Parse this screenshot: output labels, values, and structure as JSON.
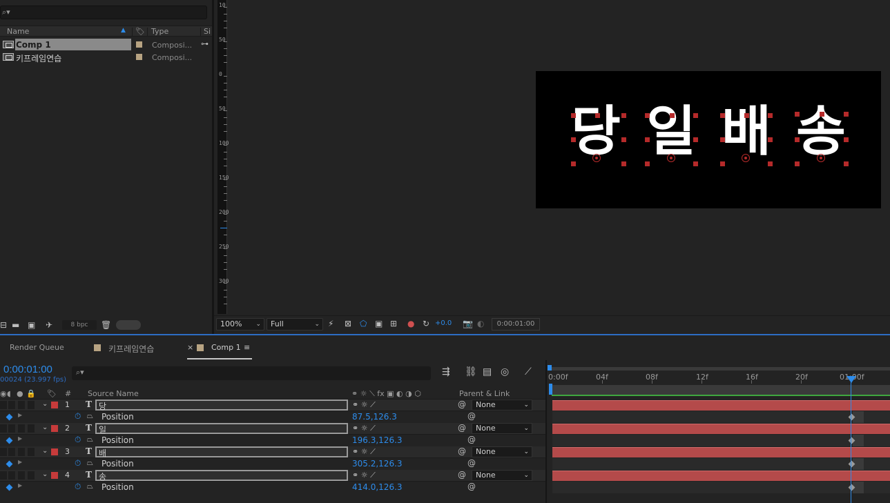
{
  "project": {
    "headers": {
      "name": "Name",
      "type": "Type",
      "size": "Si"
    },
    "items": [
      {
        "name": "Comp 1",
        "type": "Composi..."
      },
      {
        "name": "키프레임연습",
        "type": "Composi..."
      }
    ],
    "footer": {
      "bpc": "8 bpc"
    }
  },
  "viewer": {
    "ruler_labels": [
      "10",
      "50",
      "0",
      "50",
      "100",
      "150",
      "200",
      "250",
      "300"
    ],
    "glyphs": [
      "당",
      "일",
      "배",
      "송"
    ],
    "zoom": "100%",
    "resolution": "Full",
    "exposure": "+0.0",
    "timecode": "0:00:01:00"
  },
  "tabs": {
    "render_queue": "Render Queue",
    "comp_a": "키프레임연습",
    "comp_b": "Comp 1"
  },
  "timeline": {
    "current_time": "0:00:01:00",
    "fps": "00024 (23.997 fps)",
    "headers": {
      "num": "#",
      "source_name": "Source Name",
      "parent": "Parent & Link"
    },
    "layers": [
      {
        "num": "1",
        "type": "T",
        "name": "당",
        "parent": "None",
        "property": "Position",
        "value": "87.5,126.3"
      },
      {
        "num": "2",
        "type": "T",
        "name": "일",
        "parent": "None",
        "property": "Position",
        "value": "196.3,126.3"
      },
      {
        "num": "3",
        "type": "T",
        "name": "배",
        "parent": "None",
        "property": "Position",
        "value": "305.2,126.3"
      },
      {
        "num": "4",
        "type": "T",
        "name": "송",
        "parent": "None",
        "property": "Position",
        "value": "414.0,126.3"
      }
    ],
    "ruler_labels": [
      "0:00f",
      "04f",
      "08f",
      "12f",
      "16f",
      "20f",
      "01:00f"
    ]
  },
  "colors": {
    "accent": "#2d8ceb",
    "layer_label": "#c63b3b",
    "layer_bar": "#b44a4a",
    "comp_label": "#b7a382",
    "handle": "#b52a2a"
  }
}
